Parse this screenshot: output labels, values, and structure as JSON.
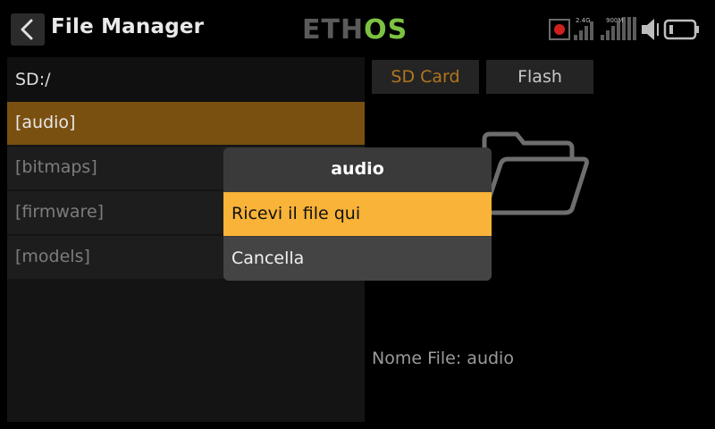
{
  "header": {
    "title": "File Manager",
    "logo_text": "ETHOS",
    "status": {
      "band_24g": "2.4G",
      "band_900m": "900M",
      "icons": [
        "record-icon",
        "signal-bars-icon",
        "speaker-icon",
        "battery-icon"
      ]
    }
  },
  "left_panel": {
    "path": "SD:/",
    "items": [
      {
        "label": "[audio]",
        "selected": true
      },
      {
        "label": "[bitmaps]",
        "selected": false
      },
      {
        "label": "[firmware]",
        "selected": false
      },
      {
        "label": "[models]",
        "selected": false
      }
    ]
  },
  "right_panel": {
    "tabs": [
      {
        "label": "SD Card",
        "active": true
      },
      {
        "label": "Flash",
        "active": false
      }
    ],
    "file_name": "Nome File: audio"
  },
  "dialog": {
    "title": "audio",
    "options": [
      {
        "label": "Ricevi il file qui",
        "highlighted": true
      },
      {
        "label": "Cancella",
        "highlighted": false
      }
    ]
  },
  "colors": {
    "accent": "#f8b338",
    "selected_row": "#7a5011",
    "logo_green": "#7cc242",
    "logo_gray": "#5a5a5a"
  }
}
